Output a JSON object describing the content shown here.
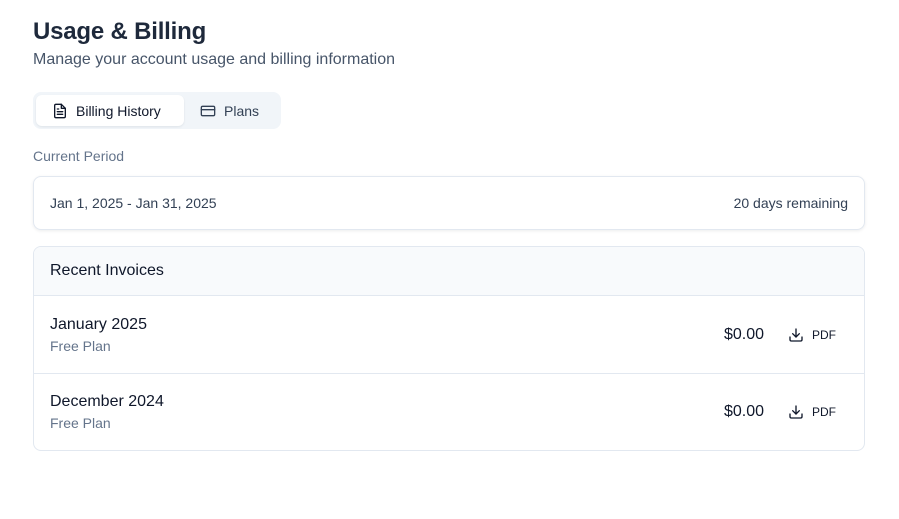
{
  "header": {
    "title": "Usage & Billing",
    "subtitle": "Manage your account usage and billing information"
  },
  "tabs": [
    {
      "label": "Billing History",
      "icon": "file-text-icon",
      "active": true
    },
    {
      "label": "Plans",
      "icon": "credit-card-icon",
      "active": false
    }
  ],
  "current_period": {
    "label": "Current Period",
    "range": "Jan 1, 2025 - Jan 31, 2025",
    "remaining": "20 days remaining"
  },
  "invoices": {
    "heading": "Recent Invoices",
    "items": [
      {
        "name": "January 2025",
        "plan": "Free Plan",
        "amount": "$0.00",
        "action": "PDF",
        "icon": "download-icon"
      },
      {
        "name": "December 2024",
        "plan": "Free Plan",
        "amount": "$0.00",
        "action": "PDF",
        "icon": "download-icon"
      }
    ]
  },
  "colors": {
    "text_primary": "#0f172a",
    "text_muted": "#64748b",
    "border": "#e2e8f0",
    "tab_track": "#f1f5f9"
  }
}
